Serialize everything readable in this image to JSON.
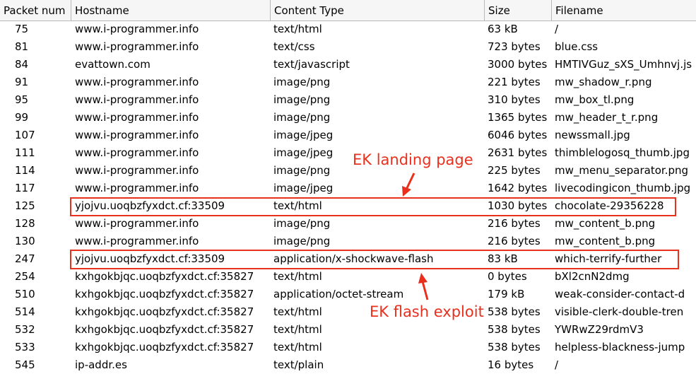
{
  "columns": {
    "packet_num": "Packet num",
    "hostname": "Hostname",
    "content_type": "Content Type",
    "size": "Size",
    "filename": "Filename"
  },
  "rows": [
    {
      "num": "75",
      "host": "www.i-programmer.info",
      "ct": "text/html",
      "size": "63 kB",
      "file": "/"
    },
    {
      "num": "81",
      "host": "www.i-programmer.info",
      "ct": "text/css",
      "size": "723 bytes",
      "file": "blue.css"
    },
    {
      "num": "84",
      "host": "evattown.com",
      "ct": "text/javascript",
      "size": "3000 bytes",
      "file": "HMTIVGuz_sXS_Umhnvj.js"
    },
    {
      "num": "91",
      "host": "www.i-programmer.info",
      "ct": "image/png",
      "size": "221 bytes",
      "file": "mw_shadow_r.png"
    },
    {
      "num": "95",
      "host": "www.i-programmer.info",
      "ct": "image/png",
      "size": "310 bytes",
      "file": "mw_box_tl.png"
    },
    {
      "num": "99",
      "host": "www.i-programmer.info",
      "ct": "image/png",
      "size": "1365 bytes",
      "file": "mw_header_t_r.png"
    },
    {
      "num": "107",
      "host": "www.i-programmer.info",
      "ct": "image/jpeg",
      "size": "6046 bytes",
      "file": "newssmall.jpg"
    },
    {
      "num": "111",
      "host": "www.i-programmer.info",
      "ct": "image/jpeg",
      "size": "2631 bytes",
      "file": "thimblelogosq_thumb.jpg"
    },
    {
      "num": "114",
      "host": "www.i-programmer.info",
      "ct": "image/png",
      "size": "225 bytes",
      "file": "mw_menu_separator.png"
    },
    {
      "num": "117",
      "host": "www.i-programmer.info",
      "ct": "image/jpeg",
      "size": "1642 bytes",
      "file": "livecodingicon_thumb.jpg"
    },
    {
      "num": "125",
      "host": "yjojvu.uoqbzfyxdct.cf:33509",
      "ct": "text/html",
      "size": "1030 bytes",
      "file": "chocolate-29356228"
    },
    {
      "num": "128",
      "host": "www.i-programmer.info",
      "ct": "image/png",
      "size": "216 bytes",
      "file": "mw_content_b.png"
    },
    {
      "num": "130",
      "host": "www.i-programmer.info",
      "ct": "image/png",
      "size": "216 bytes",
      "file": "mw_content_b.png"
    },
    {
      "num": "247",
      "host": "yjojvu.uoqbzfyxdct.cf:33509",
      "ct": "application/x-shockwave-flash",
      "size": "83 kB",
      "file": "which-terrify-further"
    },
    {
      "num": "254",
      "host": "kxhgokbjqc.uoqbzfyxdct.cf:35827",
      "ct": "text/html",
      "size": "0 bytes",
      "file": "bXl2cnN2dmg"
    },
    {
      "num": "510",
      "host": "kxhgokbjqc.uoqbzfyxdct.cf:35827",
      "ct": "application/octet-stream",
      "size": "179 kB",
      "file": "weak-consider-contact-d"
    },
    {
      "num": "514",
      "host": "kxhgokbjqc.uoqbzfyxdct.cf:35827",
      "ct": "text/html",
      "size": "538 bytes",
      "file": "visible-clerk-double-tren"
    },
    {
      "num": "532",
      "host": "kxhgokbjqc.uoqbzfyxdct.cf:35827",
      "ct": "text/html",
      "size": "538 bytes",
      "file": "YWRwZ29rdmV3"
    },
    {
      "num": "533",
      "host": "kxhgokbjqc.uoqbzfyxdct.cf:35827",
      "ct": "text/html",
      "size": "538 bytes",
      "file": "helpless-blackness-jump"
    },
    {
      "num": "545",
      "host": "ip-addr.es",
      "ct": "text/plain",
      "size": "16 bytes",
      "file": "/"
    }
  ],
  "annotations": {
    "landing": "EK landing page",
    "flash": "EK flash exploit",
    "color": "#e8301c"
  }
}
